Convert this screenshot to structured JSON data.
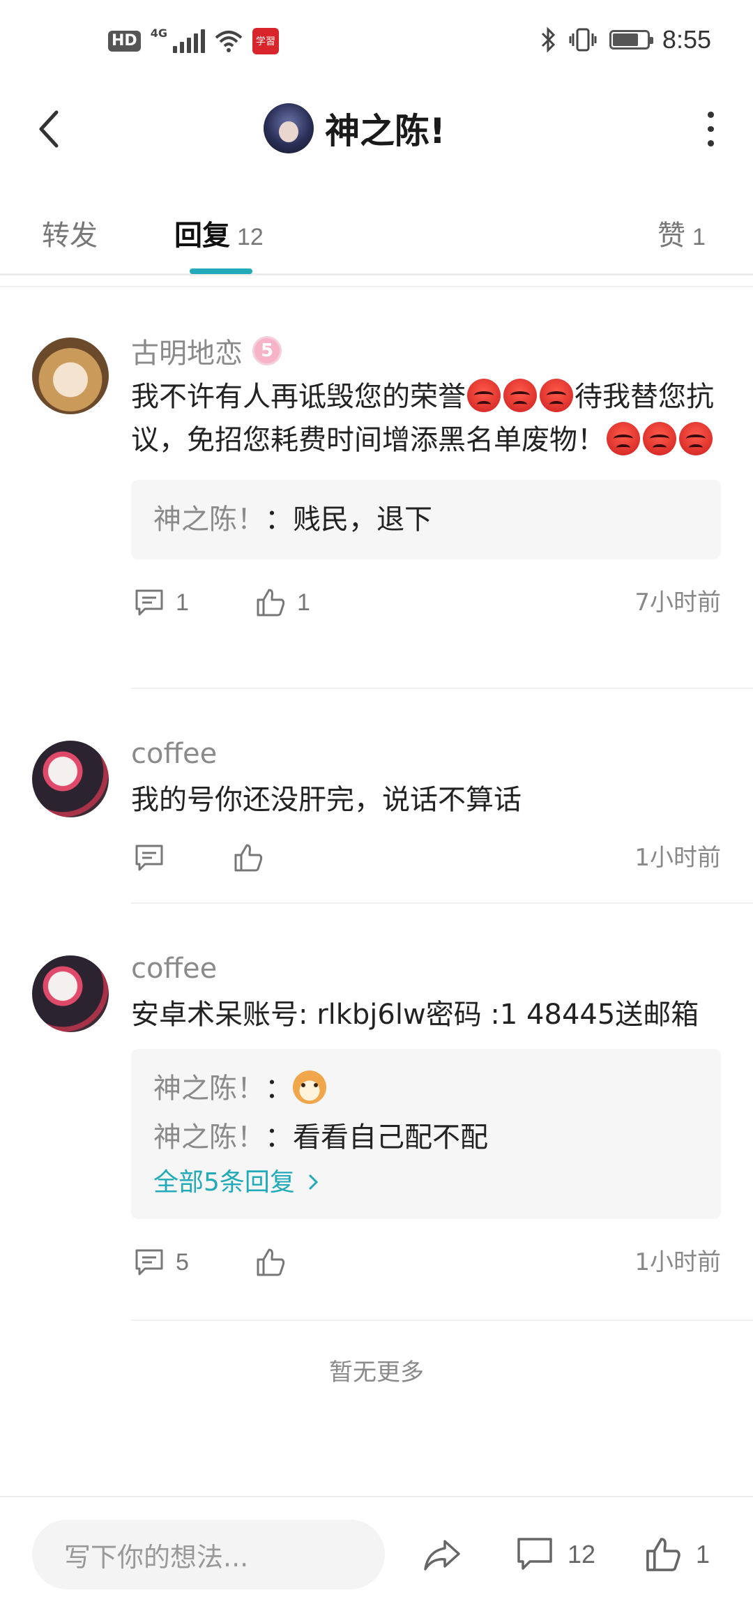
{
  "status_bar": {
    "time": "8:55",
    "left_labels": {
      "hd": "HD",
      "network": "4G",
      "app_badge": "学習"
    },
    "icons": [
      "hd-icon",
      "signal-icon",
      "wifi-icon",
      "app-badge-icon",
      "bluetooth-icon",
      "vibrate-icon",
      "battery-icon"
    ]
  },
  "header": {
    "title": "神之陈!",
    "back_icon": "chevron-left-icon",
    "more_icon": "more-vertical-icon"
  },
  "tabs": [
    {
      "label": "转发",
      "count": ""
    },
    {
      "label": "回复",
      "count": "12",
      "active": true
    },
    {
      "label": "赞",
      "count": "1"
    }
  ],
  "comments": [
    {
      "author": "古明地恋",
      "level": "5",
      "text_parts": [
        "我不许有人再诋毁您的荣誉",
        "待我替您抗议，免招您耗费时间增添黑名单废物！"
      ],
      "replies": [
        {
          "author": "神之陈！",
          "sep": "：",
          "text": "贱民，退下"
        }
      ],
      "reply_count": "1",
      "like_count": "1",
      "time": "7小时前"
    },
    {
      "author": "coffee",
      "text": "我的号你还没肝完，说话不算话",
      "reply_count": "",
      "like_count": "",
      "time": "1小时前"
    },
    {
      "author": "coffee",
      "text": "安卓术呆账号: rlkbj6lw密码 :1 48445送邮箱",
      "replies": [
        {
          "author": "神之陈！",
          "sep": "：",
          "text": ""
        },
        {
          "author": "神之陈！",
          "sep": "：",
          "text": "看看自己配不配"
        }
      ],
      "all_replies_link": "全部5条回复",
      "reply_count": "5",
      "like_count": "",
      "time": "1小时前"
    }
  ],
  "footer_note": "暂无更多",
  "bottom_bar": {
    "input_placeholder": "写下你的想法...",
    "comment_count": "12",
    "like_count": "1"
  },
  "colors": {
    "accent": "#22aab9",
    "angry_emoji": "#e02828"
  }
}
